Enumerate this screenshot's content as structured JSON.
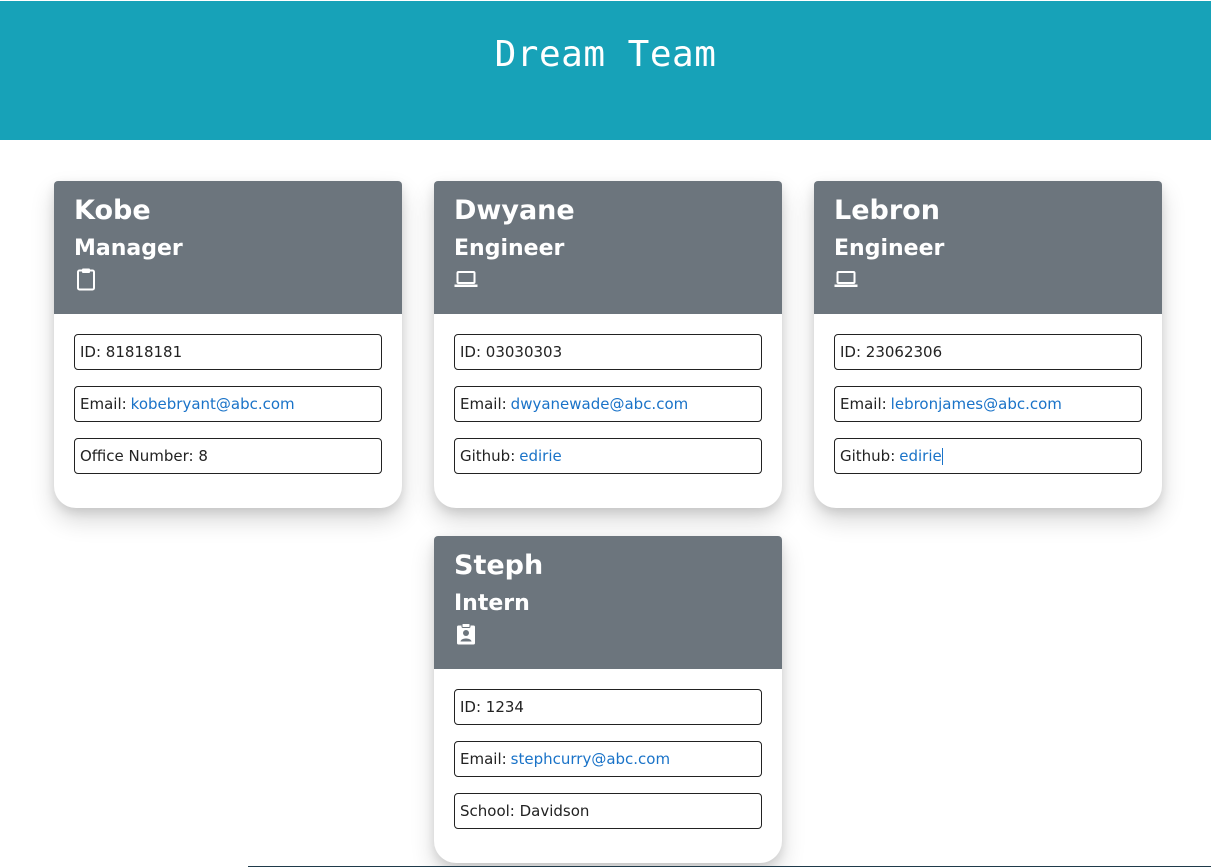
{
  "header": {
    "title": "Dream Team",
    "color": "#17a2b8"
  },
  "card_header_color": "#6c757d",
  "link_color": "#1a73c8",
  "employees": [
    {
      "name": "Kobe",
      "role": "Manager",
      "icon": "clipboard-icon",
      "id_label": "ID: 81818181",
      "email_label": "Email:",
      "email": "kobebryant@abc.com",
      "extra_label": "Office Number: 8"
    },
    {
      "name": "Dwyane",
      "role": "Engineer",
      "icon": "laptop-icon",
      "id_label": "ID: 03030303",
      "email_label": "Email:",
      "email": "dwyanewade@abc.com",
      "extra_label": "Github:",
      "extra_link": "edirie"
    },
    {
      "name": "Lebron",
      "role": "Engineer",
      "icon": "laptop-icon",
      "id_label": "ID: 23062306",
      "email_label": "Email:",
      "email": "lebronjames@abc.com",
      "extra_label": "Github:",
      "extra_link": "edirie"
    },
    {
      "name": "Steph",
      "role": "Intern",
      "icon": "id-badge-icon",
      "id_label": "ID: 1234",
      "email_label": "Email:",
      "email": "stephcurry@abc.com",
      "extra_label": "School: Davidson"
    }
  ]
}
